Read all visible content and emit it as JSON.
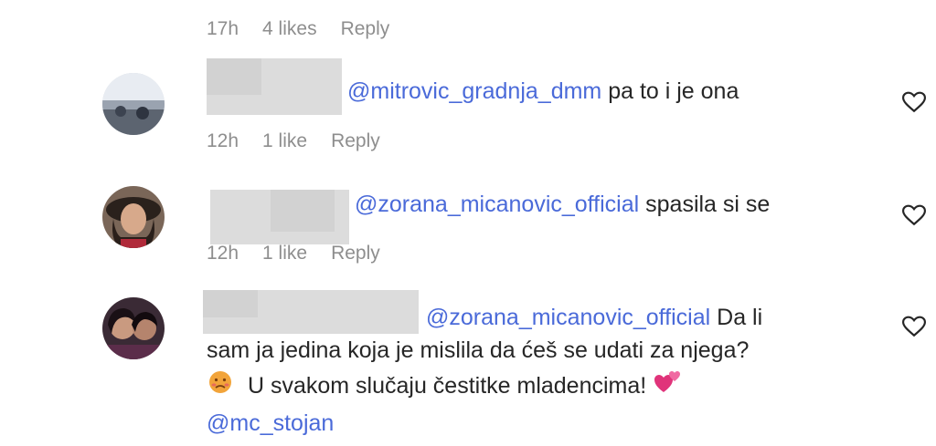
{
  "top_meta": {
    "time": "17h",
    "likes": "4 likes",
    "reply": "Reply"
  },
  "comments": [
    {
      "mention": "@mitrovic_gradnja_dmm",
      "text": "pa to i je ona",
      "time": "12h",
      "likes": "1 like",
      "reply": "Reply"
    },
    {
      "mention": "@zorana_micanovic_official",
      "text": "spasila si se",
      "time": "12h",
      "likes": "1 like",
      "reply": "Reply"
    },
    {
      "mention": "@zorana_micanovic_official",
      "text_line1": "Da li",
      "text_line2": "sam ja jedina koja je mislila da ćeš se udati za njega?",
      "text_line3": "U svakom slučaju čestitke mladencima!",
      "mention2": "@mc_stojan"
    }
  ],
  "icons": {
    "like": "heart-outline-icon",
    "emoji1": "sad-face-emoji",
    "emoji2": "two-hearts-emoji"
  },
  "colors": {
    "mention": "#4a6ad9",
    "meta": "#8e8e8e",
    "text": "#262626"
  }
}
